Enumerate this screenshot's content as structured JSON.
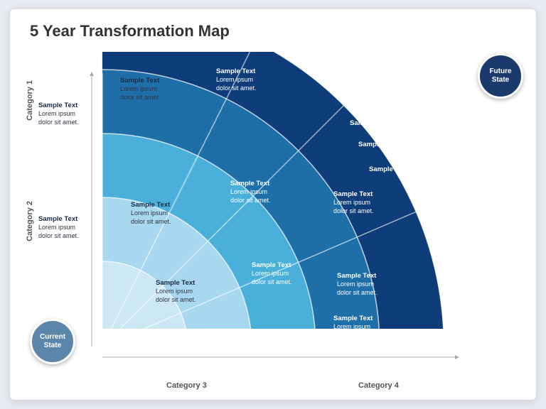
{
  "title": "5 Year Transformation Map",
  "categories": {
    "cat1": "Category 1",
    "cat2": "Category 2",
    "cat3": "Category 3",
    "cat4": "Category 4"
  },
  "states": {
    "current": "Current\nState",
    "future": "Future\nState"
  },
  "segments": [
    {
      "id": "c1-r1",
      "title": "Sample Text",
      "body": "Lorem ipsum\ndolor sit amet.",
      "theme": "light"
    },
    {
      "id": "c1-r2",
      "title": "Sample Text",
      "body": "Lorem ipsum\ndolor sit amet.",
      "theme": "light"
    },
    {
      "id": "c1-r3",
      "title": "Sample Text",
      "body": "Lorem ipsum\ndolor sit amet.",
      "theme": "medium"
    },
    {
      "id": "c1-r4-a",
      "title": "Sample Text",
      "body": "",
      "theme": "medark"
    },
    {
      "id": "c1-r4-b",
      "title": "Text",
      "body": "",
      "theme": "dark"
    },
    {
      "id": "c2-r1",
      "title": "Sample Text",
      "body": "Lorem ipsum\ndolor sit amet.",
      "theme": "light"
    },
    {
      "id": "c2-r2",
      "title": "Sample Text",
      "body": "Lorem ipsum\ndolor sit amet.",
      "theme": "light"
    },
    {
      "id": "c2-r3",
      "title": "Sample Text",
      "body": "Lorem ipsum\ndolor sit amet.",
      "theme": "medium"
    },
    {
      "id": "c2-r4",
      "title": "Sample Text",
      "body": "Lorem ipsum\ndolor sit amet.",
      "theme": "dark"
    },
    {
      "id": "c3-r2",
      "title": "Sample Text",
      "body": "Lorem ipsum\ndolor sit amet.",
      "theme": "light"
    },
    {
      "id": "c3-r3",
      "title": "Sample Text",
      "body": "Lorem ipsum\ndolor sit amet.",
      "theme": "medium"
    },
    {
      "id": "c3-r4",
      "title": "Sample Text",
      "body": "Lorem ipsum\ndolor sit amet.",
      "theme": "dark"
    },
    {
      "id": "c4-r3",
      "title": "Sample Text",
      "body": "Lorem ipsum\ndolor sit amet.",
      "theme": "medium"
    },
    {
      "id": "c4-r4",
      "title": "Sample Text",
      "body": "Lorem ipsum\ndolor sit amet.",
      "theme": "dark"
    }
  ],
  "colors": {
    "ring1": "#cce8f4",
    "ring2": "#a8d8ef",
    "ring3": "#4ab0d9",
    "ring4": "#1e6fa8",
    "ring5": "#0f3d7a",
    "divider": "rgba(255,255,255,0.7)"
  }
}
